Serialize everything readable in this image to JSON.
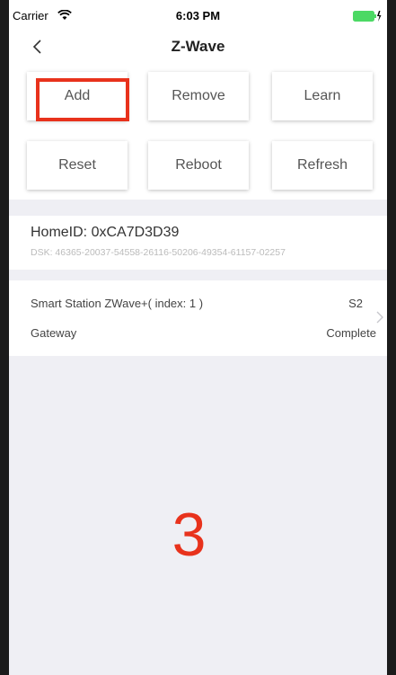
{
  "status_bar": {
    "carrier": "Carrier",
    "time": "6:03 PM"
  },
  "nav": {
    "title": "Z-Wave",
    "back_icon": "chevron-left-icon"
  },
  "buttons": {
    "add": "Add",
    "remove": "Remove",
    "learn": "Learn",
    "reset": "Reset",
    "reboot": "Reboot",
    "refresh": "Refresh"
  },
  "home": {
    "home_id": "HomeID: 0xCA7D3D39",
    "dsk": "DSK: 46365-20037-54558-26116-50206-49354-61157-02257"
  },
  "device": {
    "name": "Smart Station ZWave+( index: 1 )",
    "security": "S2",
    "type": "Gateway",
    "status": "Complete"
  },
  "overlay_number": "3",
  "colors": {
    "highlight": "#e8321c",
    "background_gray": "#efeff4",
    "battery": "#4cd964"
  }
}
